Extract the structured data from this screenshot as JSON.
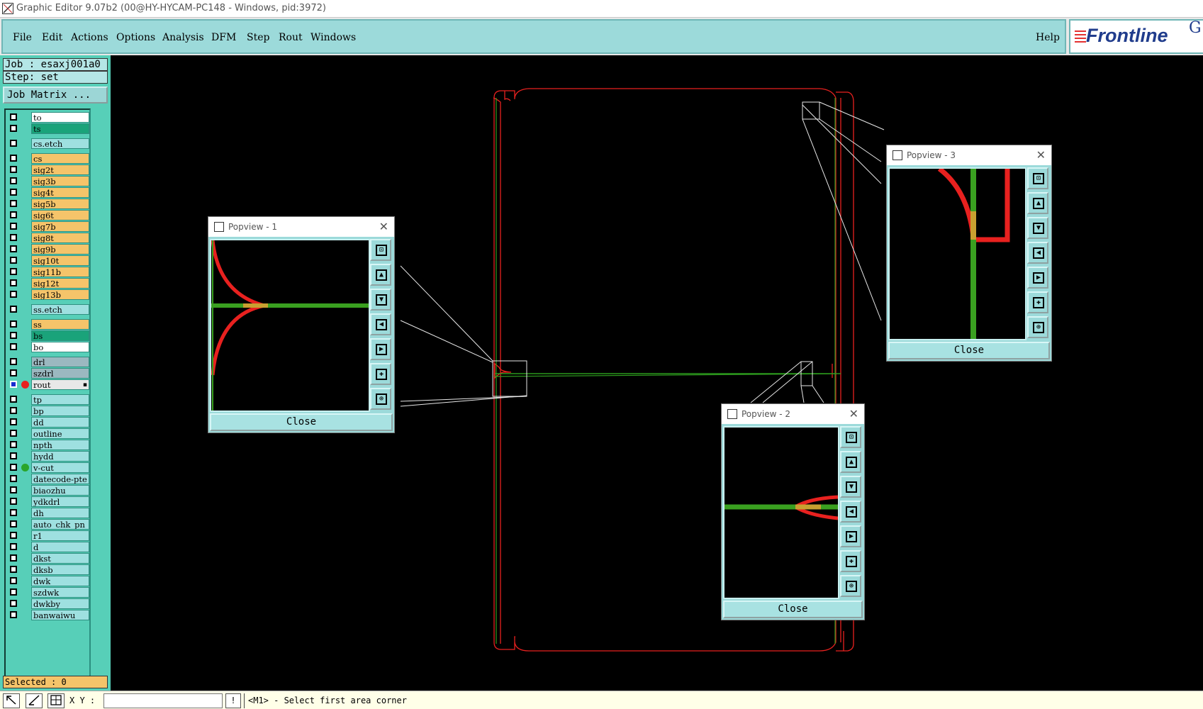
{
  "window": {
    "title": "Graphic Editor 9.07b2 (00@HY-HYCAM-PC148 - Windows, pid:3972)"
  },
  "menu": {
    "items": [
      "File",
      "Edit",
      "Actions",
      "Options",
      "Analysis",
      "DFM",
      "Step",
      "Rout",
      "Windows"
    ],
    "help": "Help"
  },
  "logo": {
    "text": "Frontline",
    "extra": "G"
  },
  "job": {
    "job_label": "Job : esaxj001a0",
    "step_label": "Step: set"
  },
  "job_matrix_button": "Job Matrix ...",
  "layers": [
    {
      "name": "to",
      "color": "#ffffff",
      "checked": true
    },
    {
      "name": "ts",
      "color": "#1aa37a",
      "checked": true
    },
    {
      "name": "cs.etch",
      "color": "#9ee0e0",
      "checked": true
    },
    {
      "name": "cs",
      "color": "#f5c46a",
      "checked": true
    },
    {
      "name": "sig2t",
      "color": "#f5c46a",
      "checked": true
    },
    {
      "name": "sig3b",
      "color": "#f5c46a",
      "checked": true
    },
    {
      "name": "sig4t",
      "color": "#f5c46a",
      "checked": true
    },
    {
      "name": "sig5b",
      "color": "#f5c46a",
      "checked": true
    },
    {
      "name": "sig6t",
      "color": "#f5c46a",
      "checked": true
    },
    {
      "name": "sig7b",
      "color": "#f5c46a",
      "checked": true
    },
    {
      "name": "sig8t",
      "color": "#f5c46a",
      "checked": true
    },
    {
      "name": "sig9b",
      "color": "#f5c46a",
      "checked": true
    },
    {
      "name": "sig10t",
      "color": "#f5c46a",
      "checked": true
    },
    {
      "name": "sig11b",
      "color": "#f5c46a",
      "checked": true
    },
    {
      "name": "sig12t",
      "color": "#f5c46a",
      "checked": true
    },
    {
      "name": "sig13b",
      "color": "#f5c46a",
      "checked": true
    },
    {
      "name": "ss.etch",
      "color": "#9ee0e0",
      "checked": true
    },
    {
      "name": "ss",
      "color": "#f5c46a",
      "checked": true
    },
    {
      "name": "bs",
      "color": "#1aa37a",
      "checked": true
    },
    {
      "name": "bo",
      "color": "#ffffff",
      "checked": true
    },
    {
      "name": "drl",
      "color": "#9bb8c0",
      "checked": true
    },
    {
      "name": "szdrl",
      "color": "#9bb8c0",
      "checked": true
    },
    {
      "name": "rout",
      "color": "#e8e8e8",
      "checked": true,
      "selected": true,
      "dot": "#e8211f"
    },
    {
      "name": "tp",
      "color": "#9ee0e0",
      "checked": true
    },
    {
      "name": "bp",
      "color": "#9ee0e0",
      "checked": true
    },
    {
      "name": "dd",
      "color": "#9ee0e0",
      "checked": true
    },
    {
      "name": "outline",
      "color": "#9ee0e0",
      "checked": true
    },
    {
      "name": "npth",
      "color": "#9ee0e0",
      "checked": true
    },
    {
      "name": "hydd",
      "color": "#9ee0e0",
      "checked": true
    },
    {
      "name": "v-cut",
      "color": "#9ee0e0",
      "checked": true,
      "dot": "#2aa52a"
    },
    {
      "name": "datecode-pte",
      "color": "#9ee0e0",
      "checked": true
    },
    {
      "name": "biaozhu",
      "color": "#9ee0e0",
      "checked": true
    },
    {
      "name": "ydkdrl",
      "color": "#9ee0e0",
      "checked": true
    },
    {
      "name": "dh",
      "color": "#9ee0e0",
      "checked": true
    },
    {
      "name": "auto_chk_pn",
      "color": "#9ee0e0",
      "checked": true
    },
    {
      "name": "r1",
      "color": "#9ee0e0",
      "checked": true
    },
    {
      "name": "d",
      "color": "#9ee0e0",
      "checked": true
    },
    {
      "name": "dkst",
      "color": "#9ee0e0",
      "checked": true
    },
    {
      "name": "dksb",
      "color": "#9ee0e0",
      "checked": true
    },
    {
      "name": "dwk",
      "color": "#9ee0e0",
      "checked": true
    },
    {
      "name": "szdwk",
      "color": "#9ee0e0",
      "checked": true
    },
    {
      "name": "dwkby",
      "color": "#9ee0e0",
      "checked": true
    },
    {
      "name": "banwaiwu",
      "color": "#9ee0e0",
      "checked": true
    }
  ],
  "selected_label": "Selected : 0",
  "popviews": [
    {
      "title": "Popview - 1",
      "close_label": "Close"
    },
    {
      "title": "Popview - 2",
      "close_label": "Close"
    },
    {
      "title": "Popview - 3",
      "close_label": "Close"
    }
  ],
  "popview_tools": [
    "zoom-fit-icon",
    "pan-up-icon",
    "pan-down-icon",
    "pan-left-icon",
    "pan-right-icon",
    "zoom-in-icon",
    "zoom-out-icon"
  ],
  "status": {
    "xy_label": "X Y :",
    "xy_value": "",
    "message": "<M1> - Select first area corner",
    "buttons": [
      "pointer-tool-icon",
      "line-tool-icon",
      "grid-tool-icon",
      "alert-icon"
    ]
  },
  "colors": {
    "rout_outline": "#e8211f",
    "vcut_line": "#2e9e1e",
    "menu_bg": "#9cdada",
    "panel_bg": "#57cfb8"
  }
}
